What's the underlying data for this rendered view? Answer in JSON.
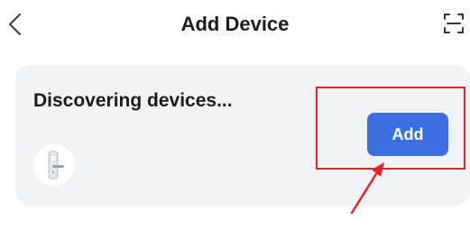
{
  "header": {
    "title": "Add Device",
    "back_icon": "chevron-left-icon",
    "scan_icon": "scan-icon"
  },
  "card": {
    "title": "Discovering devices...",
    "device_icon": "smart-lock-icon",
    "add_label": "Add"
  },
  "annotation": {
    "color": "#e4232b"
  },
  "colors": {
    "accent": "#3b6fe0",
    "card_background": "#f2f3f5"
  }
}
